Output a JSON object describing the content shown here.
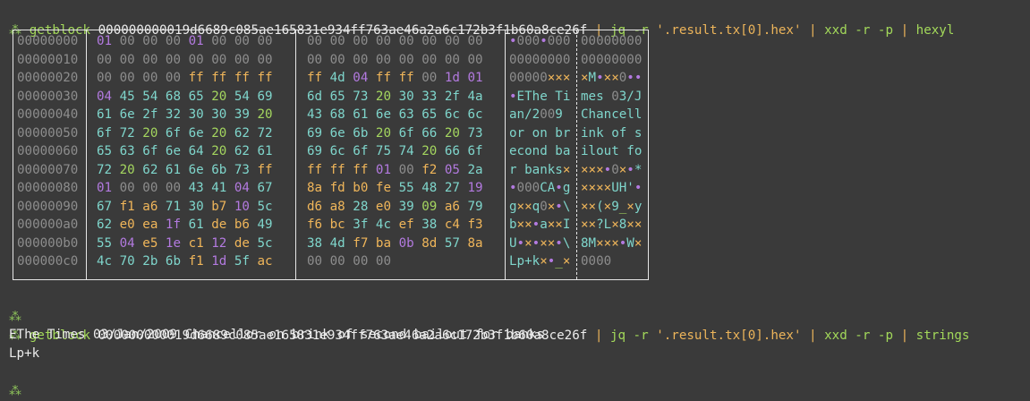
{
  "prompt_symbol": "⁂",
  "command1": {
    "program": "getblock",
    "hash": "000000000019d6689c085ae165831e934ff763ae46a2a6c172b3f1b60a8ce26f",
    "parts": [
      "jq -r",
      "'.result.tx[0].hex'",
      "xxd -r -p",
      "hexyl"
    ]
  },
  "hexdump": {
    "rows": [
      {
        "offset": "00000000",
        "hex1": "01 00 00 00 01 00 00 00",
        "hex2": "00 00 00 00 00 00 00 00",
        "asc1": "•000•000",
        "asc2": "00000000"
      },
      {
        "offset": "00000010",
        "hex1": "00 00 00 00 00 00 00 00",
        "hex2": "00 00 00 00 00 00 00 00",
        "asc1": "00000000",
        "asc2": "00000000"
      },
      {
        "offset": "00000020",
        "hex1": "00 00 00 00 ff ff ff ff",
        "hex2": "ff 4d 04 ff ff 00 1d 01",
        "asc1": "00000×××",
        "asc2": "×M•××0••"
      },
      {
        "offset": "00000030",
        "hex1": "04 45 54 68 65 20 54 69",
        "hex2": "6d 65 73 20 30 33 2f 4a",
        "asc1": "•EThe Ti",
        "asc2": "mes 03/J"
      },
      {
        "offset": "00000040",
        "hex1": "61 6e 2f 32 30 30 39 20",
        "hex2": "43 68 61 6e 63 65 6c 6c",
        "asc1": "an/2009 ",
        "asc2": "Chancell"
      },
      {
        "offset": "00000050",
        "hex1": "6f 72 20 6f 6e 20 62 72",
        "hex2": "69 6e 6b 20 6f 66 20 73",
        "asc1": "or on br",
        "asc2": "ink of s"
      },
      {
        "offset": "00000060",
        "hex1": "65 63 6f 6e 64 20 62 61",
        "hex2": "69 6c 6f 75 74 20 66 6f",
        "asc1": "econd ba",
        "asc2": "ilout fo"
      },
      {
        "offset": "00000070",
        "hex1": "72 20 62 61 6e 6b 73 ff",
        "hex2": "ff ff ff 01 00 f2 05 2a",
        "asc1": "r banks×",
        "asc2": "×××•0×•*"
      },
      {
        "offset": "00000080",
        "hex1": "01 00 00 00 43 41 04 67",
        "hex2": "8a fd b0 fe 55 48 27 19",
        "asc1": "•000CA•g",
        "asc2": "××××UH'•"
      },
      {
        "offset": "00000090",
        "hex1": "67 f1 a6 71 30 b7 10 5c",
        "hex2": "d6 a8 28 e0 39 09 a6 79",
        "asc1": "g××q0×•\\",
        "asc2": "××(×9_×y"
      },
      {
        "offset": "000000a0",
        "hex1": "62 e0 ea 1f 61 de b6 49",
        "hex2": "f6 bc 3f 4c ef 38 c4 f3",
        "asc1": "b××•a××I",
        "asc2": "××?L×8××"
      },
      {
        "offset": "000000b0",
        "hex1": "55 04 e5 1e c1 12 de 5c",
        "hex2": "38 4d f7 ba 0b 8d 57 8a",
        "asc1": "U•×•××•\\",
        "asc2": "8M×××•W×"
      },
      {
        "offset": "000000c0",
        "hex1": "4c 70 2b 6b f1 1d 5f ac",
        "hex2": "00 00 00 00",
        "asc1": "Lp+k×•_×",
        "asc2": "0000"
      }
    ]
  },
  "command2": {
    "program": "getblock",
    "hash": "000000000019d6689c085ae165831e934ff763ae46a2a6c172b3f1b60a8ce26f",
    "parts": [
      "jq -r",
      "'.result.tx[0].hex'",
      "xxd -r -p",
      "strings"
    ]
  },
  "strings_output": [
    "EThe Times 03/Jan/2009 Chancellor on brink of second bailout for banks",
    "Lp+k"
  ]
}
